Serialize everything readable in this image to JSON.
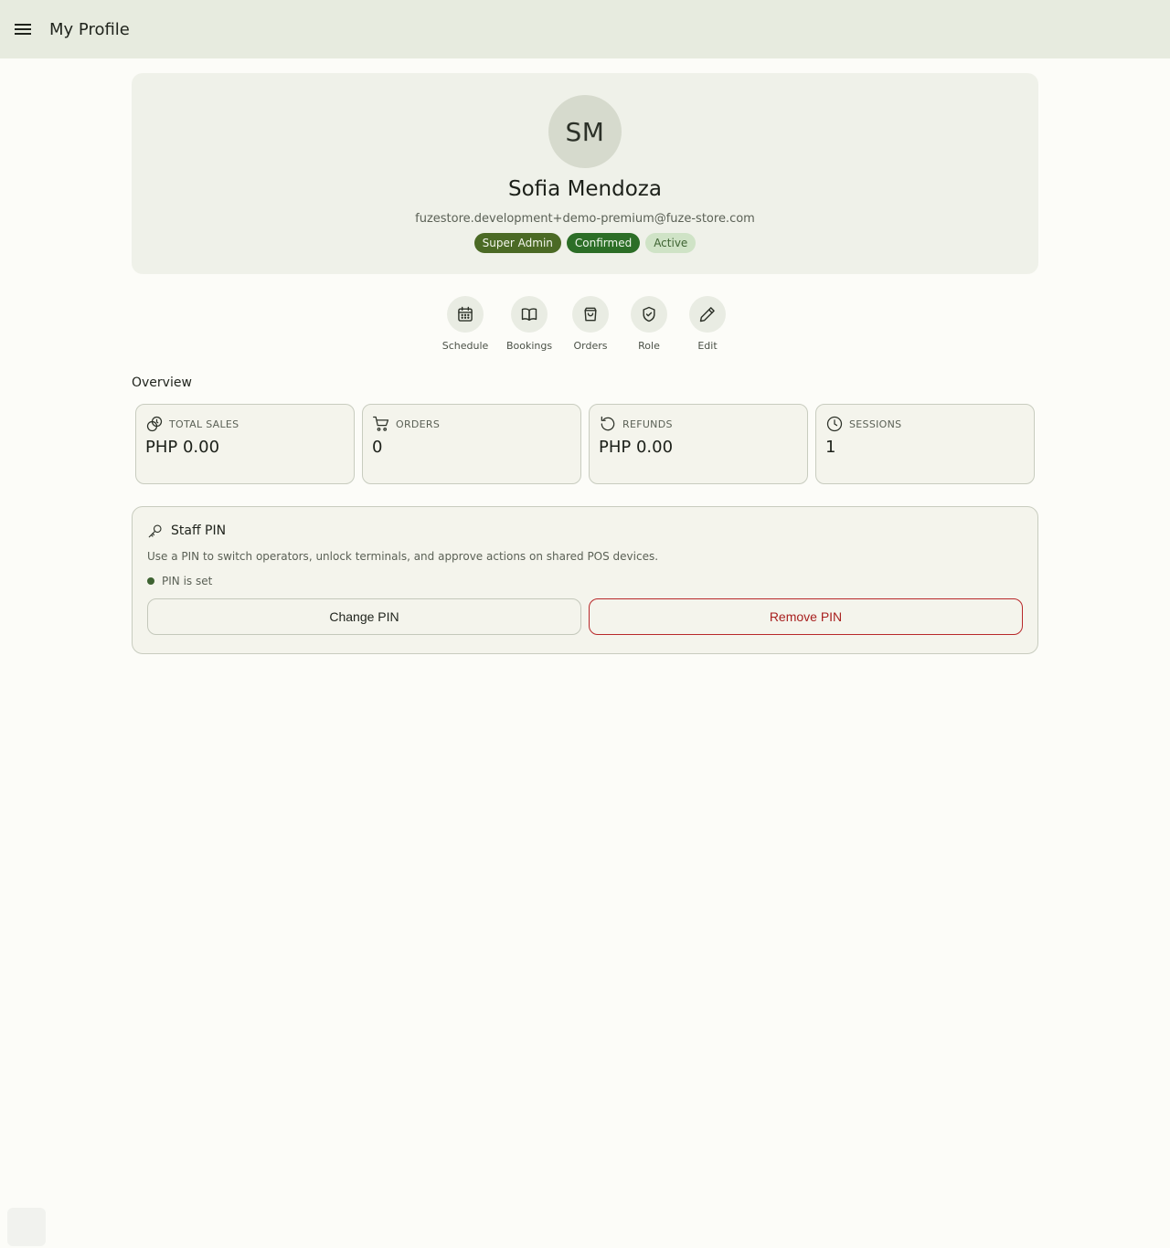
{
  "header": {
    "title": "My Profile",
    "menu_icon": "hamburger-menu-icon"
  },
  "profile": {
    "initials": "SM",
    "name": "Sofia Mendoza",
    "email": "fuzestore.development+demo-premium@fuze-store.com",
    "badges": [
      {
        "label": "Super Admin",
        "color": "#4b6a25"
      },
      {
        "label": "Confirmed",
        "color": "#2c6e27"
      },
      {
        "label": "Active",
        "color": "#cfe3c6"
      }
    ]
  },
  "actions": [
    {
      "label": "Schedule",
      "icon": "calendar-icon"
    },
    {
      "label": "Bookings",
      "icon": "book-open-icon"
    },
    {
      "label": "Orders",
      "icon": "shopping-bag-icon"
    },
    {
      "label": "Role",
      "icon": "shield-check-icon"
    },
    {
      "label": "Edit",
      "icon": "pencil-icon"
    }
  ],
  "overview": {
    "heading": "Overview",
    "stats": [
      {
        "label": "TOTAL SALES",
        "value": "PHP 0.00",
        "icon": "coins-icon"
      },
      {
        "label": "ORDERS",
        "value": "0",
        "icon": "cart-icon"
      },
      {
        "label": "REFUNDS",
        "value": "PHP 0.00",
        "icon": "refund-arrow-icon"
      },
      {
        "label": "SESSIONS",
        "value": "1",
        "icon": "clock-icon"
      }
    ]
  },
  "staff_pin": {
    "title": "Staff PIN",
    "icon": "key-icon",
    "description": "Use a PIN to switch operators, unlock terminals, and approve actions on shared POS devices.",
    "status": "PIN is set",
    "change_label": "Change PIN",
    "remove_label": "Remove PIN",
    "remove_color": "#b8282a"
  }
}
